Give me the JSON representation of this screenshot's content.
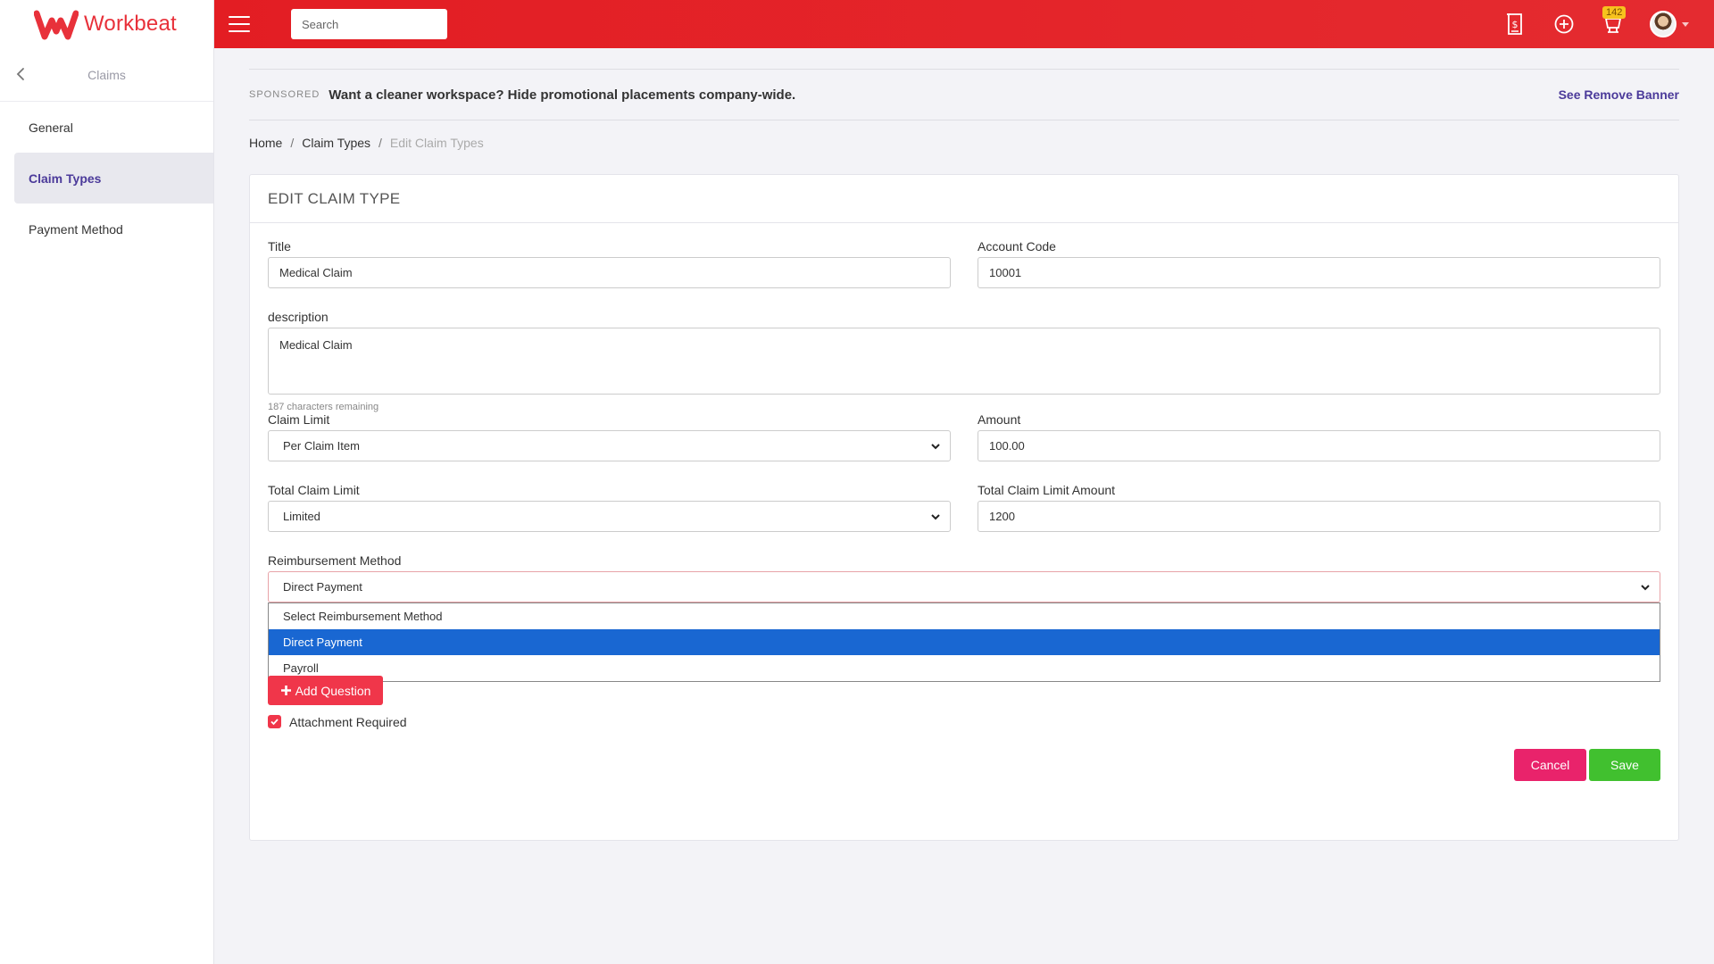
{
  "app": {
    "name": "Workbeat",
    "brand_color": "#e31d23",
    "accent_color": "#4b3a9a"
  },
  "sidebar": {
    "title": "Claims",
    "back_icon": "chevron-left-icon",
    "items": [
      {
        "label": "General",
        "active": false
      },
      {
        "label": "Claim Types",
        "active": true
      },
      {
        "label": "Payment Method",
        "active": false
      }
    ]
  },
  "topbar": {
    "search_placeholder": "Search",
    "icons": [
      "dollar-document-icon",
      "plus-circle-icon",
      "inbox-icon",
      "avatar"
    ],
    "notification_count": "142"
  },
  "sponsor": {
    "tag": "SPONSORED",
    "text": "Want a cleaner workspace? Hide promotional placements company-wide.",
    "link": "See Remove Banner"
  },
  "breadcrumb": {
    "home": "Home",
    "claim_types": "Claim Types",
    "current": "Edit Claim Types"
  },
  "form": {
    "heading": "EDIT CLAIM TYPE",
    "title_label": "Title",
    "title_value": "Medical Claim",
    "account_code_label": "Account Code",
    "account_code_value": "10001",
    "description_label": "description",
    "description_value": "Medical Claim",
    "char_counter": "187 characters remaining",
    "claim_limit_label": "Claim Limit",
    "claim_limit_value": "Per Claim Item",
    "amount_label": "Amount",
    "amount_value": "100.00",
    "total_claim_limit_label": "Total Claim Limit",
    "total_claim_limit_value": "Limited",
    "total_claim_limit_amount_label": "Total Claim Limit Amount",
    "total_claim_limit_amount_value": "1200",
    "reimbursement_label": "Reimbursement Method",
    "reimbursement_value": "Direct Payment",
    "reimbursement_options": [
      "Select Reimbursement Method",
      "Direct Payment",
      "Payroll"
    ],
    "reimbursement_selected_index": 1,
    "add_question": "Add Question",
    "attachment_label": "Attachment Required",
    "attachment_checked": true,
    "cancel": "Cancel",
    "save": "Save"
  }
}
